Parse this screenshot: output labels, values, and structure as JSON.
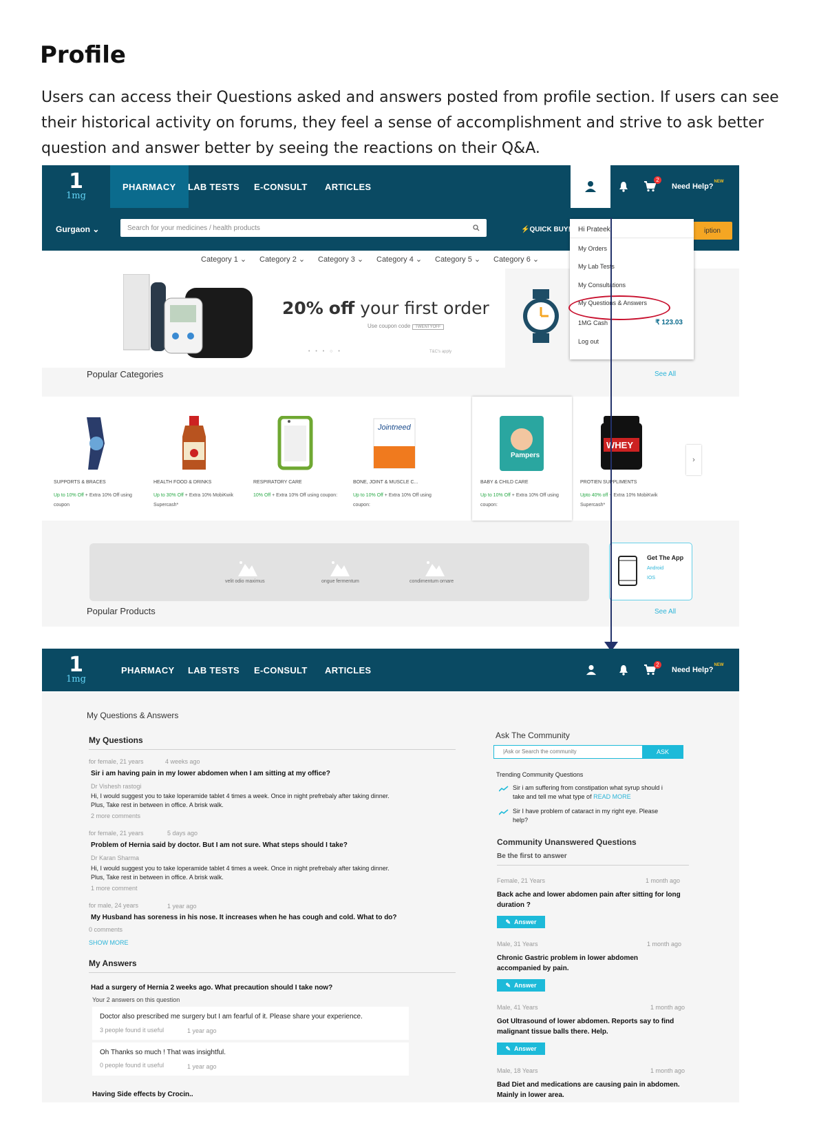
{
  "heading": "Profile",
  "intro": "Users can access their Questions asked and answers posted from profile section. If users can see their historical activity on forums, they feel a sense of accomplishment and strive to ask better question and answer better by seeing the reactions on their Q&A.",
  "header": {
    "logo_main": "1",
    "logo_sub": "1mg",
    "nav": [
      "PHARMACY",
      "LAB TESTS",
      "E-CONSULT",
      "ARTICLES"
    ],
    "cart_count": "2",
    "help_label": "Need Help?",
    "help_badge": "NEW",
    "city": "Gurgaon",
    "search_placeholder": "Search for your medicines / health products",
    "quick_buy": "QUICK BUY!",
    "orange_btn_partial": "iption",
    "categories": [
      "Category 1",
      "Category 2",
      "Category 3",
      "Category 4",
      "Category 5",
      "Category 6"
    ]
  },
  "banner": {
    "offer_big": "20%",
    "offer_bold": "off",
    "offer_rest": "your first order",
    "coupon_label": "Use coupon code",
    "coupon_code": "TWENTYOFF",
    "tc": "T&C's apply"
  },
  "dropdown": {
    "greeting": "Hi Prateek",
    "items": [
      "My Orders",
      "My Lab Tests",
      "My Consultations",
      "My Questions & Answers"
    ],
    "cash_label": "1MG Cash",
    "cash_value": "₹ 123.03",
    "logout": "Log out"
  },
  "popular_categories": {
    "title": "Popular Categories",
    "see_all": "See All",
    "items": [
      {
        "name": "SUPPORTS & BRACES",
        "offer": "Up to 10% Off",
        "rest": "+ Extra 10% Off using coupon"
      },
      {
        "name": "HEALTH FOOD & DRINKS",
        "offer": "Up to 30% Off",
        "rest": "+ Extra 10% MobiKwik Supercash*"
      },
      {
        "name": "RESPIRATORY CARE",
        "offer": "10% Off",
        "rest": "+ Extra 10% Off using coupon:"
      },
      {
        "name": "BONE, JOINT & MUSCLE C...",
        "offer": "Up to 10% Off",
        "rest": "+ Extra 10% Off using coupon:"
      },
      {
        "name": "BABY & CHILD CARE",
        "offer": "Up to 10% Off",
        "rest": "+ Extra 10% Off using coupon:"
      },
      {
        "name": "PROTIEN SUPPLIMENTS",
        "offer": "Upto 40% off",
        "rest": "+ Extra 10% MobiKwik Supercash*"
      }
    ]
  },
  "slides": [
    "velit odio maximus",
    "ongue fermentum",
    "condimentum ornare"
  ],
  "get_app": {
    "title": "Get The App",
    "android": "Android",
    "ios": "IOS"
  },
  "popular_products": {
    "title": "Popular Products",
    "see_all": "See All"
  },
  "qa_page": {
    "title": "My Questions & Answers",
    "my_questions_heading": "My Questions",
    "questions": [
      {
        "meta": "for female, 21 years",
        "time": "4 weeks ago",
        "q": "Sir i am having pain in my lower abdomen when I am sitting at my office?",
        "doctor": "Dr Vishesh rastogi",
        "answer1": "Hi, I would suggest you to take loperamide tablet 4 times a week. Once in night prefrebaly after taking dinner.",
        "answer2": "Plus, Take rest in between in office. A brisk walk.",
        "comments": "2 more comments"
      },
      {
        "meta": "for female, 21 years",
        "time": "5 days ago",
        "q": "Problem of Hernia said by doctor. But I am not sure. What steps should I take?",
        "doctor": "Dr Karan Sharma",
        "answer1": "Hi, I would suggest you to take loperamide tablet 4 times a week. Once in night prefrebaly after taking dinner.",
        "answer2": "Plus, Take rest in between in office. A brisk walk.",
        "comments": "1 more comment"
      },
      {
        "meta": "for male, 24 years",
        "time": "1 year ago",
        "q": "My Husband has soreness in his nose. It increases when he has cough and cold. What to do?",
        "comments": "0 comments"
      }
    ],
    "show_more": "SHOW MORE",
    "my_answers_heading": "My Answers",
    "answered_question": "Had a surgery of Hernia 2 weeks ago. What precaution should I take now?",
    "answers_count": "Your 2 answers on this question",
    "answers": [
      {
        "text": "Doctor also prescribed me surgery but I am fearful of it. Please share your experience.",
        "useful": "3 people found it useful",
        "time": "1 year ago"
      },
      {
        "text": "Oh Thanks so much ! That was insightful.",
        "useful": "0 people found it useful",
        "time": "1 year ago"
      }
    ],
    "next_question_partial": "Having Side effects by Crocin..",
    "ask": {
      "title": "Ask The Community",
      "placeholder": "|Ask or Search the community",
      "button": "ASK"
    },
    "trending": {
      "title": "Trending Community Questions",
      "items": [
        {
          "text": "Sir i am suffering from constipation what syrup should i take and tell me what type of",
          "more": "READ MORE"
        },
        {
          "text": "Sir I have problem of cataract in my right eye. Please help?"
        }
      ]
    },
    "unanswered": {
      "title": "Community Unanswered Questions",
      "subtitle": "Be the first to answer",
      "answer_label": "Answer",
      "items": [
        {
          "meta": "Female, 21 Years",
          "time": "1 month ago",
          "q": "Back ache and lower abdomen pain after sitting for long duration ?"
        },
        {
          "meta": "Male, 31 Years",
          "time": "1 month ago",
          "q": "Chronic Gastric problem in lower abdomen accompanied by pain."
        },
        {
          "meta": "Male, 41 Years",
          "time": "1 month ago",
          "q": "Got Ultrasound of lower abdomen. Reports say to find malignant tissue balls there. Help."
        },
        {
          "meta": "Male, 18 Years",
          "time": "1 month ago",
          "q": "Bad Diet and medications are causing pain in abdomen. Mainly in lower area."
        }
      ]
    }
  },
  "colors": {
    "navy": "#0a4a63",
    "nav_active": "#0b6b8d",
    "teal": "#1dbad9",
    "green": "#27a845",
    "orange": "#f5a623",
    "highlight_red": "#c8102e",
    "arrow": "#23326b"
  }
}
